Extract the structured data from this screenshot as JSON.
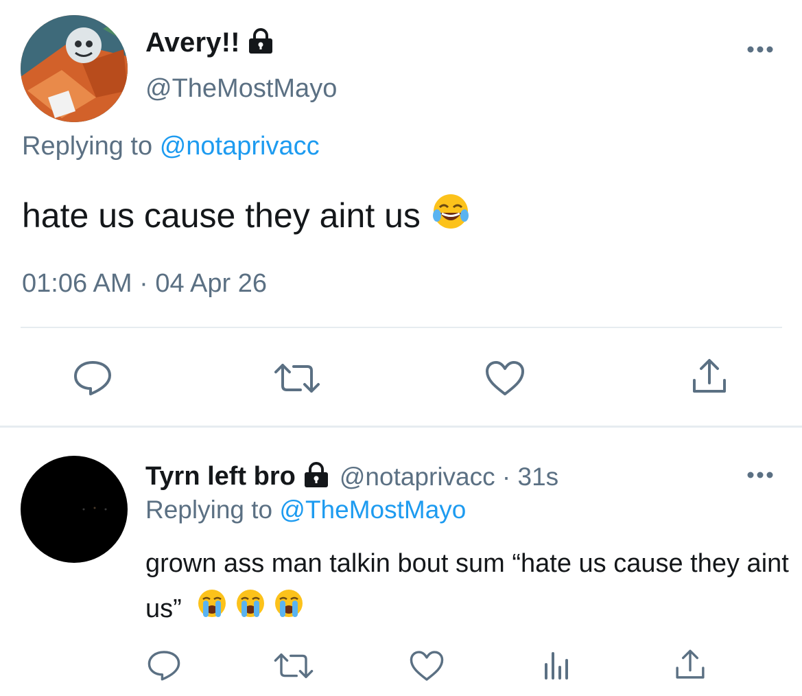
{
  "main_tweet": {
    "display_name": "Avery!!",
    "handle": "@TheMostMayo",
    "replying_prefix": "Replying to",
    "replying_to": "@notaprivacc",
    "text": "hate us cause they aint us",
    "emoji": "face-with-tears-of-joy",
    "timestamp": "01:06 AM · 04 Apr 26",
    "actions": [
      "reply-icon",
      "retweet-icon",
      "like-icon",
      "share-icon"
    ]
  },
  "reply_tweet": {
    "display_name": "Tyrn left bro",
    "handle_time": "@notaprivacc · 31s",
    "replying_prefix": "Replying to",
    "replying_to": "@TheMostMayo",
    "text": "grown ass man talkin bout sum “hate us cause they aint us”",
    "emojis": [
      "loudly-crying-face",
      "loudly-crying-face",
      "loudly-crying-face"
    ],
    "actions": [
      "reply-icon",
      "retweet-icon",
      "like-icon",
      "analytics-icon",
      "share-icon"
    ]
  },
  "colors": {
    "text_primary": "#14171a",
    "text_secondary": "#5b7083",
    "link": "#1d9bf0",
    "divider": "#e6ecf0",
    "icon": "#5b7083"
  }
}
